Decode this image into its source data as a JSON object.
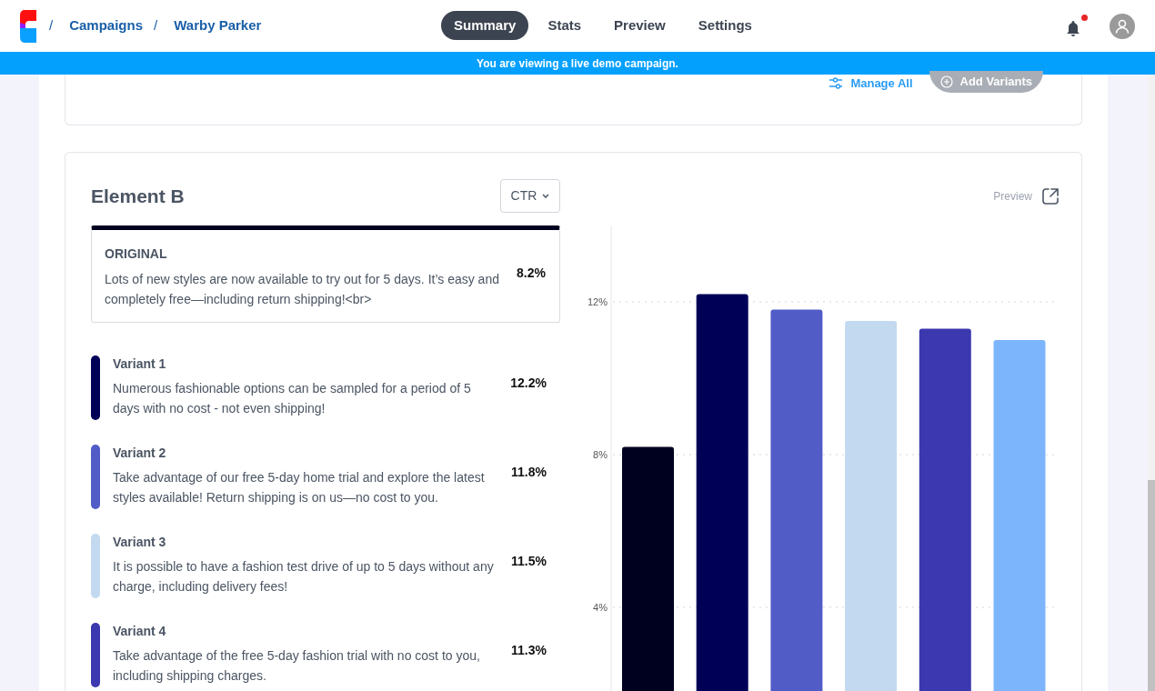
{
  "breadcrumb": [
    {
      "label": "Campaigns"
    },
    {
      "label": "Warby Parker"
    }
  ],
  "separator": "/",
  "tabs": [
    {
      "label": "Summary",
      "selected": true
    },
    {
      "label": "Stats",
      "selected": false
    },
    {
      "label": "Preview",
      "selected": false
    },
    {
      "label": "Settings",
      "selected": false
    }
  ],
  "notifications": {
    "unread": true
  },
  "banner": "You are viewing a live demo campaign.",
  "top_card": {
    "manage_all": "Manage All",
    "add_variants": {
      "label": "Add Variants",
      "disabled": true
    }
  },
  "element": {
    "title": "Element B",
    "metric": "CTR",
    "preview": "Preview",
    "original": {
      "label": "ORIGINAL",
      "text": "Lots of new styles are now available to try out for 5 days. It’s easy and completely free—including return shipping!<br>",
      "value": "8.2%",
      "color": "#00001f"
    },
    "variants": [
      {
        "name": "Variant 1",
        "text": "Numerous fashionable options can be sampled for a period of 5 days with no cost - not even shipping!",
        "value": "12.2%",
        "color": "#000057"
      },
      {
        "name": "Variant 2",
        "text": "Take advantage of our free 5-day home trial and explore the latest styles available! Return shipping is on us—no cost to you.",
        "value": "11.8%",
        "color": "#525cc6"
      },
      {
        "name": "Variant 3",
        "text": "It is possible to have a fashion test drive of up to 5 days without any charge, including delivery fees!",
        "value": "11.5%",
        "color": "#c3d9f0"
      },
      {
        "name": "Variant 4",
        "text": "Take advantage of the free 5-day fashion trial with no cost to you, including shipping charges.",
        "value": "11.3%",
        "color": "#3b38b0"
      }
    ],
    "chart_data": {
      "type": "bar",
      "ylim": [
        0,
        14
      ],
      "grid": true,
      "yticks": [
        {
          "value": 4,
          "label": "4%"
        },
        {
          "value": 8,
          "label": "8%"
        },
        {
          "value": 12,
          "label": "12%"
        }
      ],
      "series": [
        {
          "values": [
            8.2,
            12.2,
            11.8,
            11.5,
            11.3,
            11.0
          ],
          "colors": [
            "#00001f",
            "#000057",
            "#525cc6",
            "#c3d9f0",
            "#3b38b0",
            "#7cb5fb"
          ]
        }
      ]
    }
  }
}
